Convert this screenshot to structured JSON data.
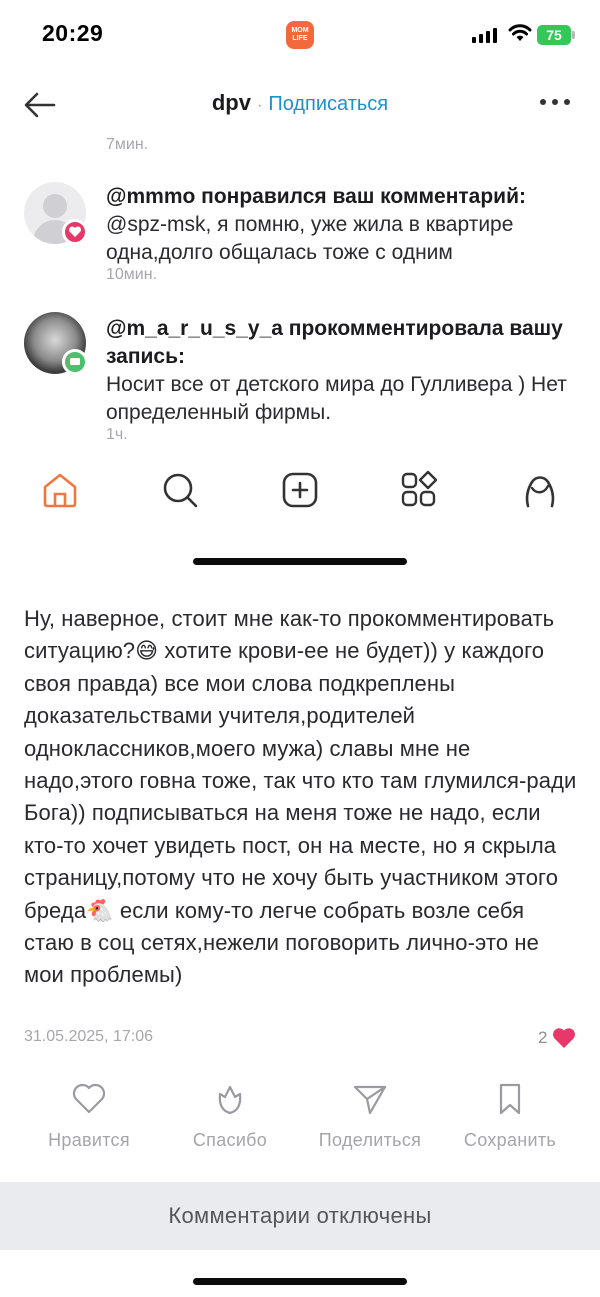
{
  "status_bar": {
    "time": "20:29",
    "app_badge": "MOM LIFE",
    "battery": "75"
  },
  "nav": {
    "username": "dpv",
    "separator": "·",
    "subscribe_label": "Подписаться"
  },
  "feed_top_time": "7мин.",
  "notifications": [
    {
      "user": "@mmmo",
      "action": " понравился ваш комментарий:",
      "text": "@spz-msk, я помню, уже жила в квартире одна,долго общалась тоже с одним",
      "time": "10мин."
    },
    {
      "user": "@m_a_r_u_s_y_a",
      "action": " прокомментировала вашу запись:",
      "text": "Носит все от детского мира до Гулливера ) Нет определенный фирмы.",
      "time": "1ч."
    }
  ],
  "post": {
    "body": "Ну, наверное, стоит мне как-то прокомментировать ситуацию?😅 хотите крови-ее не будет)) у каждого своя правда) все мои слова подкреплены доказательствами учителя,родителей одноклассников,моего мужа) славы мне не надо,этого говна тоже, так что кто там глумился-ради Бога)) подписываться на меня тоже не надо, если кто-то хочет увидеть пост, он на месте, но я скрыла страницу,потому что не хочу быть участником этого бреда🐔 если кому-то легче собрать возле себя стаю в соц сетях,нежели поговорить лично-это не мои проблемы)",
    "date": "31.05.2025, 17:06",
    "likes": "2"
  },
  "actions": {
    "like": "Нравится",
    "thanks": "Спасибо",
    "share": "Поделиться",
    "save": "Сохранить"
  },
  "comments_disabled": "Комментарии отключены",
  "colors": {
    "accent": "#1f8fcf",
    "home_active": "#f2763f",
    "like": "#e8386a",
    "comment_badge": "#4cc06d"
  }
}
